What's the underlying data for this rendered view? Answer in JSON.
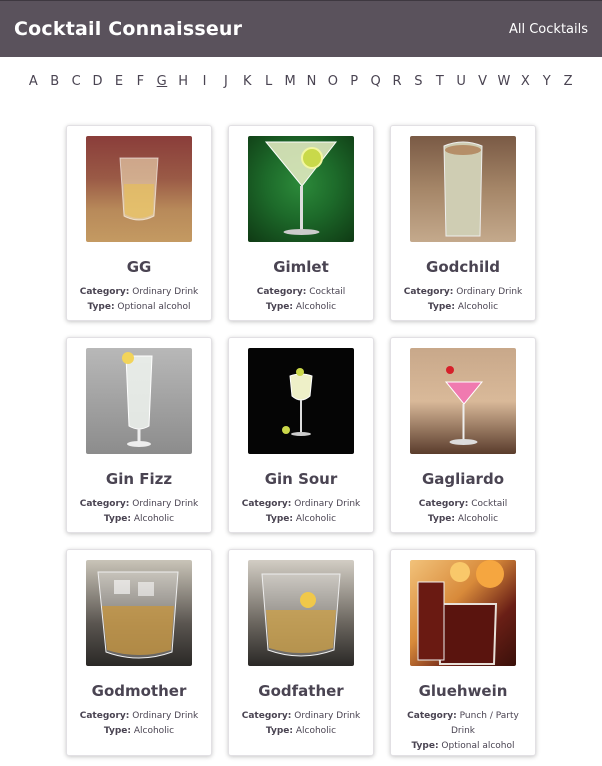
{
  "header": {
    "title": "Cocktail Connaisseur",
    "nav_label": "All Cocktails"
  },
  "alphabet": {
    "letters": [
      "A",
      "B",
      "C",
      "D",
      "E",
      "F",
      "G",
      "H",
      "I",
      "J",
      "K",
      "L",
      "M",
      "N",
      "O",
      "P",
      "Q",
      "R",
      "S",
      "T",
      "U",
      "V",
      "W",
      "X",
      "Y",
      "Z"
    ],
    "active": "G"
  },
  "labels": {
    "category": "Category:",
    "type": "Type:"
  },
  "cocktails": [
    {
      "name": "GG",
      "category": "Ordinary Drink",
      "type": "Optional alcohol",
      "image": "gg-glass-photo"
    },
    {
      "name": "Gimlet",
      "category": "Cocktail",
      "type": "Alcoholic",
      "image": "gimlet-martini-photo"
    },
    {
      "name": "Godchild",
      "category": "Ordinary Drink",
      "type": "Alcoholic",
      "image": "godchild-creamy-glass-photo"
    },
    {
      "name": "Gin Fizz",
      "category": "Ordinary Drink",
      "type": "Alcoholic",
      "image": "gin-fizz-tall-glass-photo"
    },
    {
      "name": "Gin Sour",
      "category": "Ordinary Drink",
      "type": "Alcoholic",
      "image": "gin-sour-glass-photo"
    },
    {
      "name": "Gagliardo",
      "category": "Cocktail",
      "type": "Alcoholic",
      "image": "gagliardo-pink-cocktail-photo"
    },
    {
      "name": "Godmother",
      "category": "Ordinary Drink",
      "type": "Alcoholic",
      "image": "godmother-rocks-glass-photo"
    },
    {
      "name": "Godfather",
      "category": "Ordinary Drink",
      "type": "Alcoholic",
      "image": "godfather-rocks-glass-photo"
    },
    {
      "name": "Gluehwein",
      "category": "Punch / Party Drink",
      "type": "Optional alcohol",
      "image": "gluehwein-mug-photo"
    }
  ],
  "colors": {
    "header_bg": "#5a525c",
    "text": "#4a4452",
    "card_border": "#e2e0e4"
  }
}
